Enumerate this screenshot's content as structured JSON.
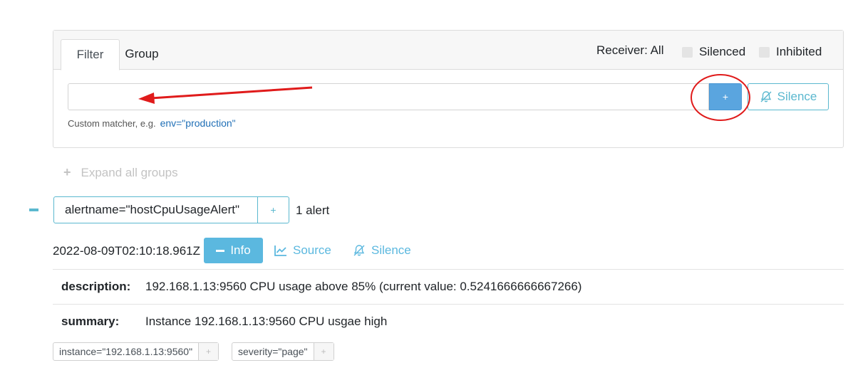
{
  "filter_card": {
    "tabs": [
      "Filter",
      "Group"
    ],
    "receiver_label": "Receiver: All",
    "silenced_label": "Silenced",
    "inhibited_label": "Inhibited",
    "input_value": "",
    "add_button_label": "+",
    "silence_button_label": "Silence",
    "hint_text": "Custom matcher, e.g.",
    "hint_example": "env=\"production\""
  },
  "expand_all_label": "Expand all groups",
  "group": {
    "label": "alertname=\"hostCpuUsageAlert\"",
    "add_label": "+",
    "count": "1 alert"
  },
  "alert": {
    "timestamp": "2022-08-09T02:10:18.961Z",
    "info_label": "Info",
    "source_label": "Source",
    "silence_label": "Silence",
    "annotations": [
      {
        "key": "description:",
        "value": "192.168.1.13:9560 CPU usage above 85% (current value: 0.5241666666667266)"
      },
      {
        "key": "summary:",
        "value": "Instance 192.168.1.13:9560 CPU usgae high"
      }
    ],
    "labels": [
      {
        "text": "instance=\"192.168.1.13:9560\"",
        "add": "+"
      },
      {
        "text": "severity=\"page\"",
        "add": "+"
      }
    ]
  },
  "colors": {
    "accent": "#5bb8df",
    "primary_button": "#5aa5df",
    "annotation_red": "#e01b1b"
  }
}
